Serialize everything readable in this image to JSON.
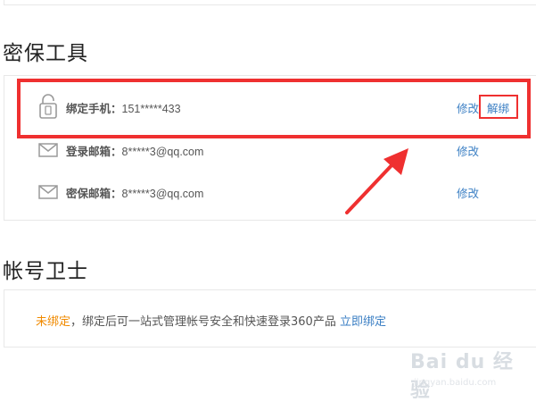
{
  "security_tools": {
    "title": "密保工具",
    "rows": [
      {
        "icon": "phone-lock-icon",
        "label": "绑定手机：",
        "value": "151*****433",
        "modify_label": "修改",
        "unbind_label": "解绑"
      },
      {
        "icon": "mail-icon",
        "label": "登录邮箱：",
        "value": "8*****3@qq.com",
        "modify_label": "修改"
      },
      {
        "icon": "mail-icon",
        "label": "密保邮箱：",
        "value": "8*****3@qq.com",
        "modify_label": "修改"
      }
    ]
  },
  "account_guard": {
    "title": "帐号卫士",
    "status": "未绑定",
    "description": "，绑定后可一站式管理帐号安全和快速登录360产品",
    "bind_link": "立即绑定"
  },
  "annotation": {
    "color": "#ef3030"
  },
  "watermark": {
    "text": "Bai du 经验",
    "url": "jingyan.baidu.com"
  },
  "colors": {
    "link": "#3b7fc4",
    "status_warning": "#f08a00",
    "border": "#e8e8e8"
  }
}
